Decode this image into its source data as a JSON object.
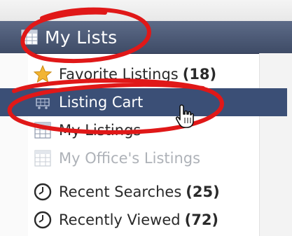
{
  "header": {
    "title": "My Lists",
    "icon": "list-grid-icon"
  },
  "menu": {
    "items": [
      {
        "label": "Favorite Listings",
        "count": "(18)",
        "icon": "star-icon",
        "state": "normal"
      },
      {
        "label": "Listing Cart",
        "count": "",
        "icon": "cart-icon",
        "state": "active"
      },
      {
        "label": "My Listings",
        "count": "",
        "icon": "table-icon",
        "state": "normal"
      },
      {
        "label": "My Office's Listings",
        "count": "",
        "icon": "table-icon",
        "state": "disabled"
      },
      {
        "label": "Recent Searches",
        "count": "(25)",
        "icon": "clock-icon",
        "state": "normal"
      },
      {
        "label": "Recently Viewed",
        "count": "(72)",
        "icon": "clock-icon",
        "state": "normal"
      }
    ]
  },
  "colors": {
    "header_bg": "#4a5776",
    "active_bg": "#3b4f76",
    "annotation_red": "#e01818",
    "star": "#f2b533"
  }
}
